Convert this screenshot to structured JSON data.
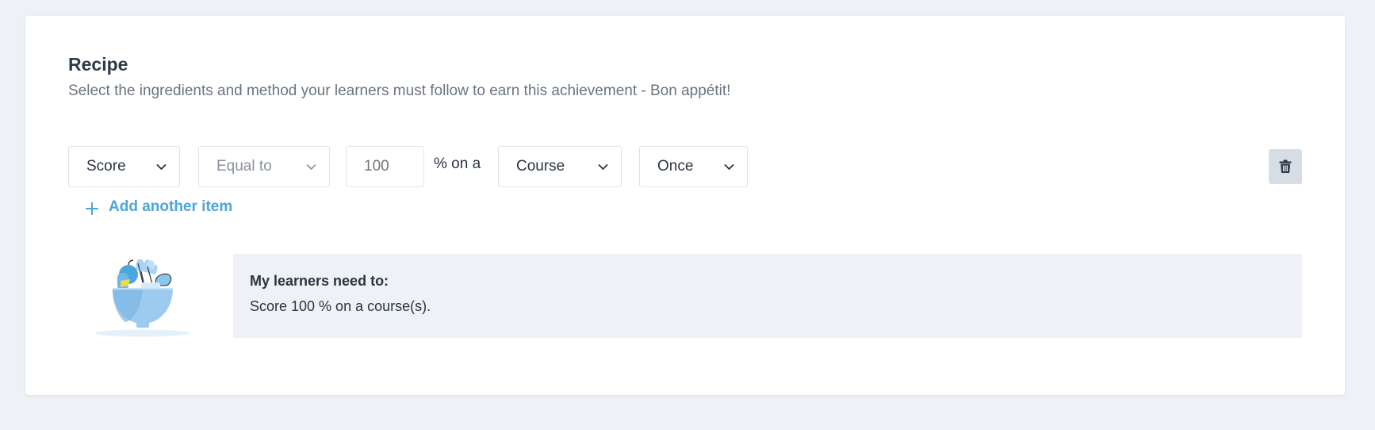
{
  "recipe": {
    "title": "Recipe",
    "subtitle": "Select the ingredients and method your learners must follow to earn this achievement - Bon appétit!"
  },
  "rule": {
    "metric": "Score",
    "comparator_placeholder": "Equal to",
    "value_placeholder": "100",
    "connector_text": "% on a",
    "target": "Course",
    "frequency": "Once"
  },
  "actions": {
    "add_item_label": "Add another item"
  },
  "summary": {
    "title": "My learners need to:",
    "text": "Score 100 % on a course(s)."
  },
  "icons": {
    "dropdown": "chevron-down-icon",
    "delete": "trash-icon",
    "add": "plus-icon",
    "illustration": "bowl-illustration"
  },
  "colors": {
    "accent": "#4aa6dd",
    "background": "#eef1f5",
    "delete_button": "#d7dde4"
  }
}
